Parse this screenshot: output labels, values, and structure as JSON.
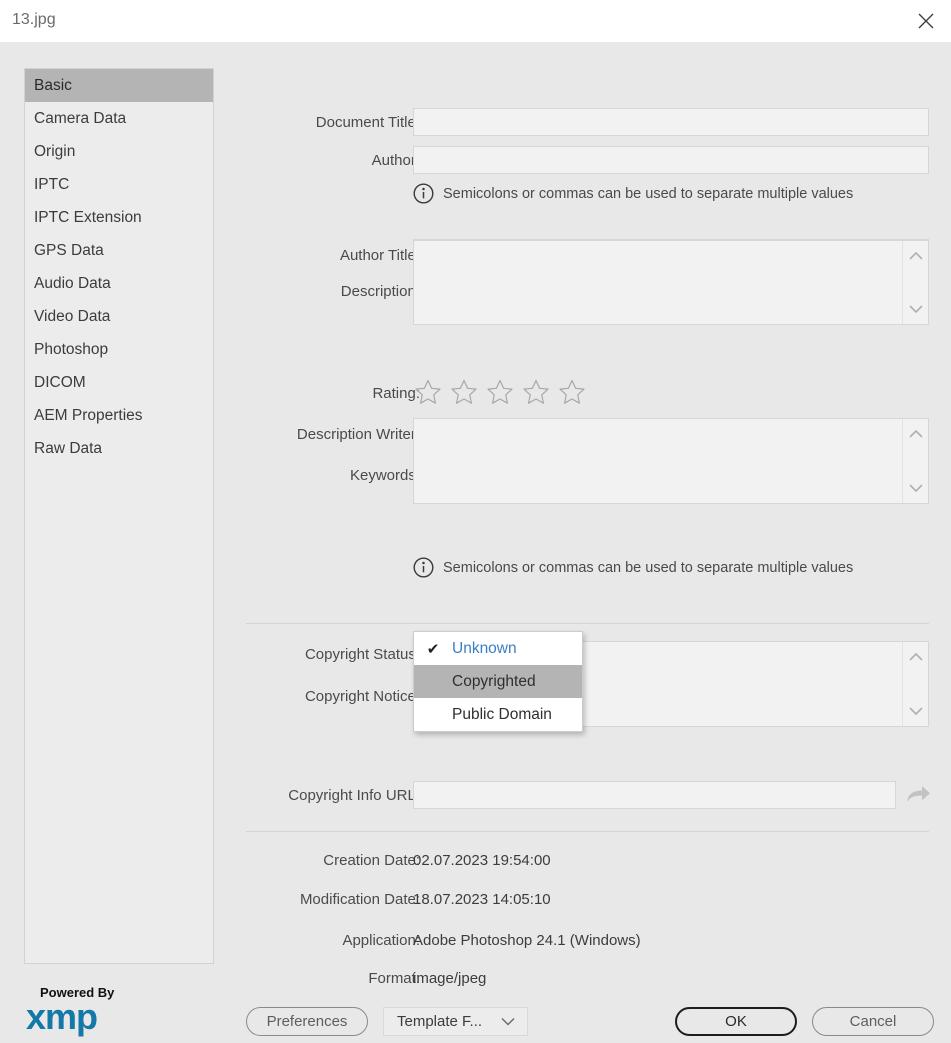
{
  "window": {
    "title": "13.jpg",
    "close_icon": "close-icon"
  },
  "sidebar": {
    "items": [
      {
        "label": "Basic",
        "selected": true
      },
      {
        "label": "Camera Data",
        "selected": false
      },
      {
        "label": "Origin",
        "selected": false
      },
      {
        "label": "IPTC",
        "selected": false
      },
      {
        "label": "IPTC Extension",
        "selected": false
      },
      {
        "label": "GPS Data",
        "selected": false
      },
      {
        "label": "Audio Data",
        "selected": false
      },
      {
        "label": "Video Data",
        "selected": false
      },
      {
        "label": "Photoshop",
        "selected": false
      },
      {
        "label": "DICOM",
        "selected": false
      },
      {
        "label": "AEM Properties",
        "selected": false
      },
      {
        "label": "Raw Data",
        "selected": false
      }
    ]
  },
  "form": {
    "document_title_label": "Document Title:",
    "document_title_value": "",
    "author_label": "Author:",
    "author_value": "",
    "author_hint": "Semicolons or commas can be used to separate multiple values",
    "author_title_label": "Author Title:",
    "author_title_value": "",
    "description_label": "Description:",
    "description_value": "",
    "rating_label": "Rating:",
    "rating_value": 0,
    "rating_max": 5,
    "description_writer_label": "Description Writer:",
    "description_writer_value": "",
    "keywords_label": "Keywords:",
    "keywords_value": "",
    "keywords_hint": "Semicolons or commas can be used to separate multiple values",
    "copyright_status_label": "Copyright Status:",
    "copyright_status_value": "Unknown",
    "copyright_status_options": [
      {
        "label": "Unknown",
        "checked": true,
        "hovered": false
      },
      {
        "label": "Copyrighted",
        "checked": false,
        "hovered": true
      },
      {
        "label": "Public Domain",
        "checked": false,
        "hovered": false
      }
    ],
    "copyright_notice_label": "Copyright Notice:",
    "copyright_notice_value": "",
    "copyright_url_label": "Copyright Info URL:",
    "copyright_url_value": "",
    "copyright_url_go_icon": "go-to-link-arrow-icon",
    "creation_date_label": "Creation Date:",
    "creation_date_value": "02.07.2023 19:54:00",
    "modification_date_label": "Modification Date:",
    "modification_date_value": "18.07.2023 14:05:10",
    "application_label": "Application:",
    "application_value": "Adobe Photoshop 24.1 (Windows)",
    "format_label": "Format:",
    "format_value": "image/jpeg"
  },
  "footer": {
    "logo_powered_by": "Powered By",
    "logo_name": "xmp",
    "preferences_label": "Preferences",
    "template_label": "Template F...",
    "ok_label": "OK",
    "cancel_label": "Cancel"
  },
  "colors": {
    "dialog_bg": "#e8e8e8",
    "field_bg": "#f2f2f2",
    "selection": "#b4b4b4",
    "accent_blue": "#3a7fc4",
    "logo_blue": "#1478a8"
  }
}
